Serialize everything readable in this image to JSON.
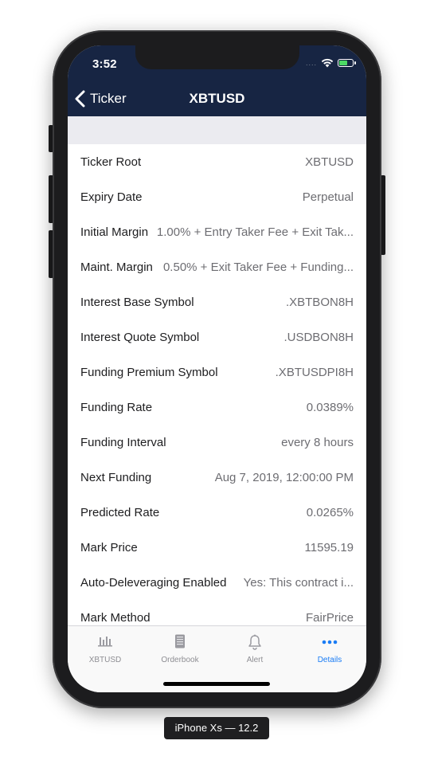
{
  "status_bar": {
    "time": "3:52",
    "signal": "....",
    "battery_color": "#4cd964"
  },
  "nav": {
    "back_label": "Ticker",
    "title": "XBTUSD"
  },
  "colors": {
    "header": "#172543",
    "tint": "#1a7cf5"
  },
  "details": [
    {
      "label": "Ticker Root",
      "value": "XBTUSD"
    },
    {
      "label": "Expiry Date",
      "value": "Perpetual"
    },
    {
      "label": "Initial Margin",
      "value": "1.00% + Entry Taker Fee + Exit Tak..."
    },
    {
      "label": "Maint. Margin",
      "value": "0.50% + Exit Taker Fee + Funding..."
    },
    {
      "label": "Interest Base Symbol",
      "value": ".XBTBON8H"
    },
    {
      "label": "Interest Quote Symbol",
      "value": ".USDBON8H"
    },
    {
      "label": "Funding Premium Symbol",
      "value": ".XBTUSDPI8H"
    },
    {
      "label": "Funding Rate",
      "value": "0.0389%"
    },
    {
      "label": "Funding Interval",
      "value": "every 8 hours"
    },
    {
      "label": "Next Funding",
      "value": "Aug 7, 2019, 12:00:00 PM"
    },
    {
      "label": "Predicted Rate",
      "value": "0.0265%"
    },
    {
      "label": "Mark Price",
      "value": "11595.19"
    },
    {
      "label": "Auto-Deleveraging Enabled",
      "value": "Yes: This contract i..."
    },
    {
      "label": "Mark Method",
      "value": "FairPrice"
    }
  ],
  "tabs": [
    {
      "label": "XBTUSD",
      "icon": "bar-chart-icon",
      "active": false
    },
    {
      "label": "Orderbook",
      "icon": "orderbook-icon",
      "active": false
    },
    {
      "label": "Alert",
      "icon": "bell-icon",
      "active": false
    },
    {
      "label": "Details",
      "icon": "more-icon",
      "active": true
    }
  ],
  "device_label": "iPhone Xs — 12.2"
}
